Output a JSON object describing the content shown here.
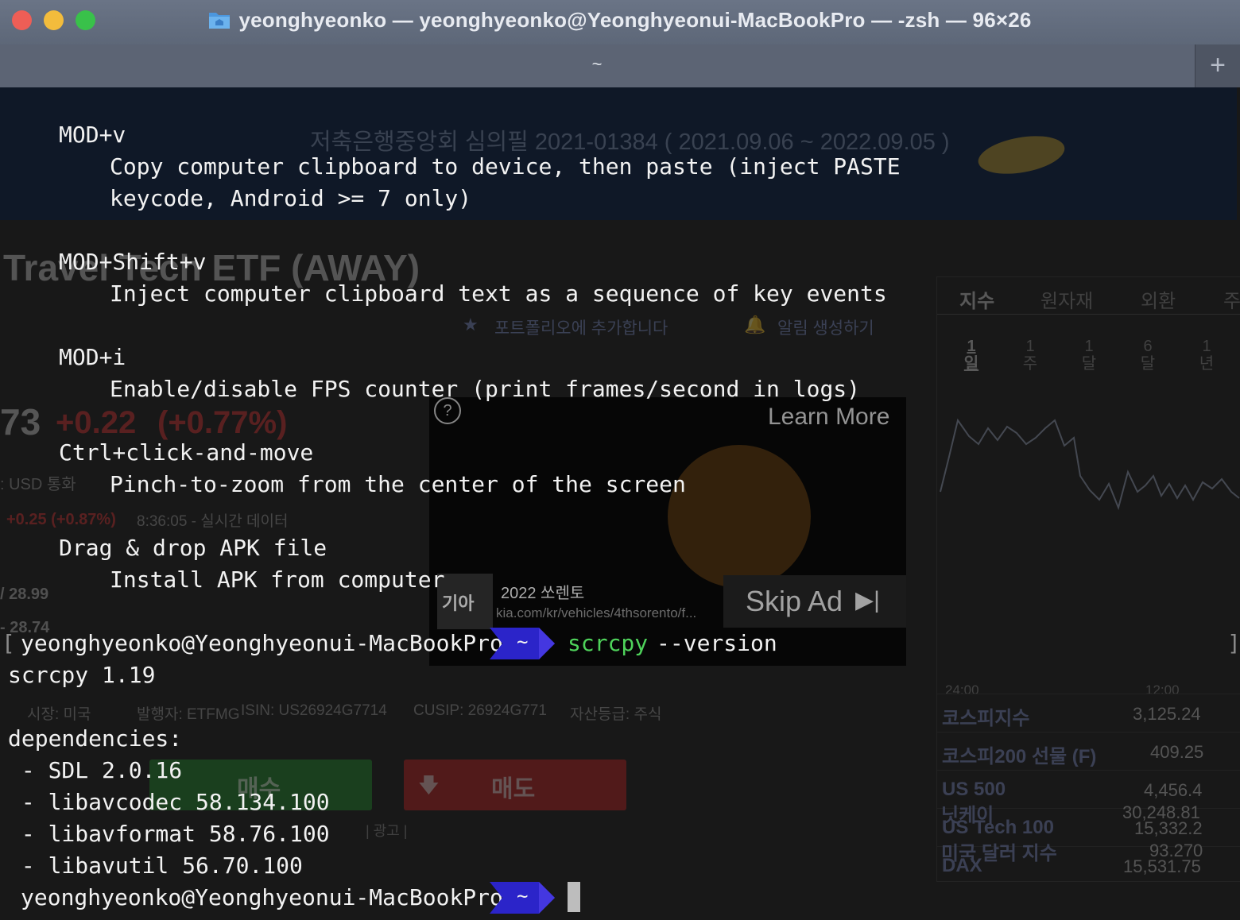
{
  "window": {
    "title": "yeonghyeonko — yeonghyeonko@Yeonghyeonui-MacBookPro — -zsh — 96×26",
    "tab_label": "~",
    "new_tab_symbol": "+",
    "folder_icon": "folder-icon",
    "colors": {
      "close": "#ee5e56",
      "minimize": "#f3bc3c",
      "maximize": "#39c14a",
      "prompt_arrow": "#2b24c9",
      "command": "#4fd35b"
    }
  },
  "terminal": {
    "help": [
      {
        "key": "MOD+v",
        "desc": [
          "Copy computer clipboard to device, then paste (inject PASTE",
          "keycode, Android >= 7 only)"
        ]
      },
      {
        "key": "MOD+Shift+v",
        "desc": [
          "Inject computer clipboard text as a sequence of key events"
        ]
      },
      {
        "key": "MOD+i",
        "desc": [
          "Enable/disable FPS counter (print frames/second in logs)"
        ]
      },
      {
        "key": "Ctrl+click-and-move",
        "desc": [
          "Pinch-to-zoom from the center of the screen"
        ]
      },
      {
        "key": "Drag & drop APK file",
        "desc": [
          "Install APK from computer"
        ]
      }
    ],
    "prompt_user": "yeonghyeonko@Yeonghyeonui-MacBookPro",
    "prompt_dir": "~",
    "command": "scrcpy",
    "command_args": "--version",
    "output": [
      "scrcpy 1.19",
      "dependencies:",
      " - SDL 2.0.16",
      " - libavcodec 58.134.100",
      " - libavformat 58.76.100",
      " - libavutil 56.70.100"
    ]
  },
  "background_page": {
    "notice": "저축은행중앙회 심의필 2021-01384 ( 2021.09.06 ~ 2022.09.05 )",
    "title": "Travel Tech ETF (AWAY)",
    "add_portfolio": "포트폴리오에 추가합니다",
    "create_alert": "알림 생성하기",
    "price_suffix": "73",
    "change": "+0.22",
    "change_pct": "(+0.77%)",
    "currency": ": USD 통화",
    "after_change": "+0.25 (+0.87%)",
    "after_time": "8:36:05 - 실시간 데이터",
    "range1": "/ 28.99",
    "range2": "- 28.74",
    "meta": [
      "시장: 미국",
      "발행자: ETFMG",
      "ISIN: US26924G7714",
      "CUSIP: 26924G771",
      "자산등급: 주식"
    ],
    "buy": "매수",
    "sell": "매도",
    "ad_label": "| 광고 |",
    "ad": {
      "learn_more": "Learn More",
      "skip": "Skip Ad",
      "brand": "기아",
      "headline": "2022 쏘렌토",
      "url": "kia.com/kr/vehicles/4thsorento/f..."
    },
    "tabs": [
      "지수",
      "원자재",
      "외환",
      "주"
    ],
    "periods": [
      "1 일",
      "1 주",
      "1 달",
      "6 달",
      "1 년"
    ],
    "chart_times": [
      "24:00",
      "12:00"
    ],
    "indices": [
      {
        "name": "코스피지수",
        "value": "3,125.24"
      },
      {
        "name": "코스피200 선물 (F)",
        "value": "409.25"
      },
      {
        "name": "US 500",
        "value": "4,456.4"
      },
      {
        "name": "US Tech 100",
        "value": "15,332.2"
      },
      {
        "name": "DAX",
        "value": "15,531.75"
      },
      {
        "name": "닛케이",
        "value": "30,248.81"
      },
      {
        "name": "미국 달러 지수",
        "value": "93.270"
      }
    ]
  }
}
